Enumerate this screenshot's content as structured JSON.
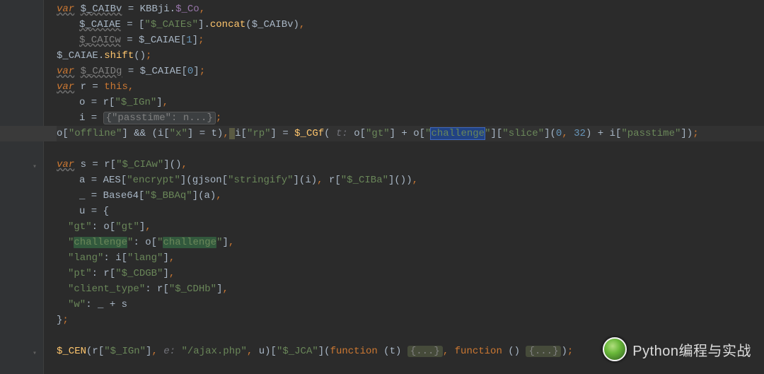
{
  "watermark": {
    "text": "Python编程与实战"
  },
  "t": {
    "var": "var",
    "this": "this",
    "function": "function",
    "CAIBv": "$_CAIBv",
    "KBBji": "KBBji",
    "Co": "$_Co",
    "CAIAE": "$_CAIAE",
    "CAIEs": "\"$_CAIEs\"",
    "concat": "concat",
    "CAICw": "$_CAICw",
    "one": "1",
    "zero": "0",
    "shift": "shift",
    "CAIDg": "$_CAIDg",
    "r": "r",
    "o": "o",
    "i": "i",
    "t": "t",
    "s": "s",
    "a": "a",
    "u": "u",
    "und": "_",
    "IGn": "\"$_IGn\"",
    "passfold": "{\"passtime\": n...}",
    "offline": "\"offline\"",
    "x": "\"x\"",
    "rp": "\"rp\"",
    "CGf": "$_CGf",
    "tlab": "t:",
    "gt": "\"gt\"",
    "challenge": "\"challenge\"",
    "slice": "\"slice\"",
    "thirtytwo": "32",
    "passtime": "\"passtime\"",
    "CIAw": "\"$_CIAw\"",
    "AES": "AES",
    "encrypt": "\"encrypt\"",
    "gjson": "gjson",
    "stringify": "\"stringify\"",
    "CIBa": "\"$_CIBa\"",
    "Base64": "Base64",
    "BBAq": "\"$_BBAq\"",
    "lang": "\"lang\"",
    "pt": "\"pt\"",
    "CDGB": "\"$_CDGB\"",
    "client_type": "\"client_type\"",
    "CDHb": "\"$_CDHb\"",
    "w": "\"w\"",
    "CEN": "$_CEN",
    "elab": "e:",
    "ajax": "\"/ajax.php\"",
    "JCA": "\"$_JCA\"",
    "brc": "{...}"
  }
}
